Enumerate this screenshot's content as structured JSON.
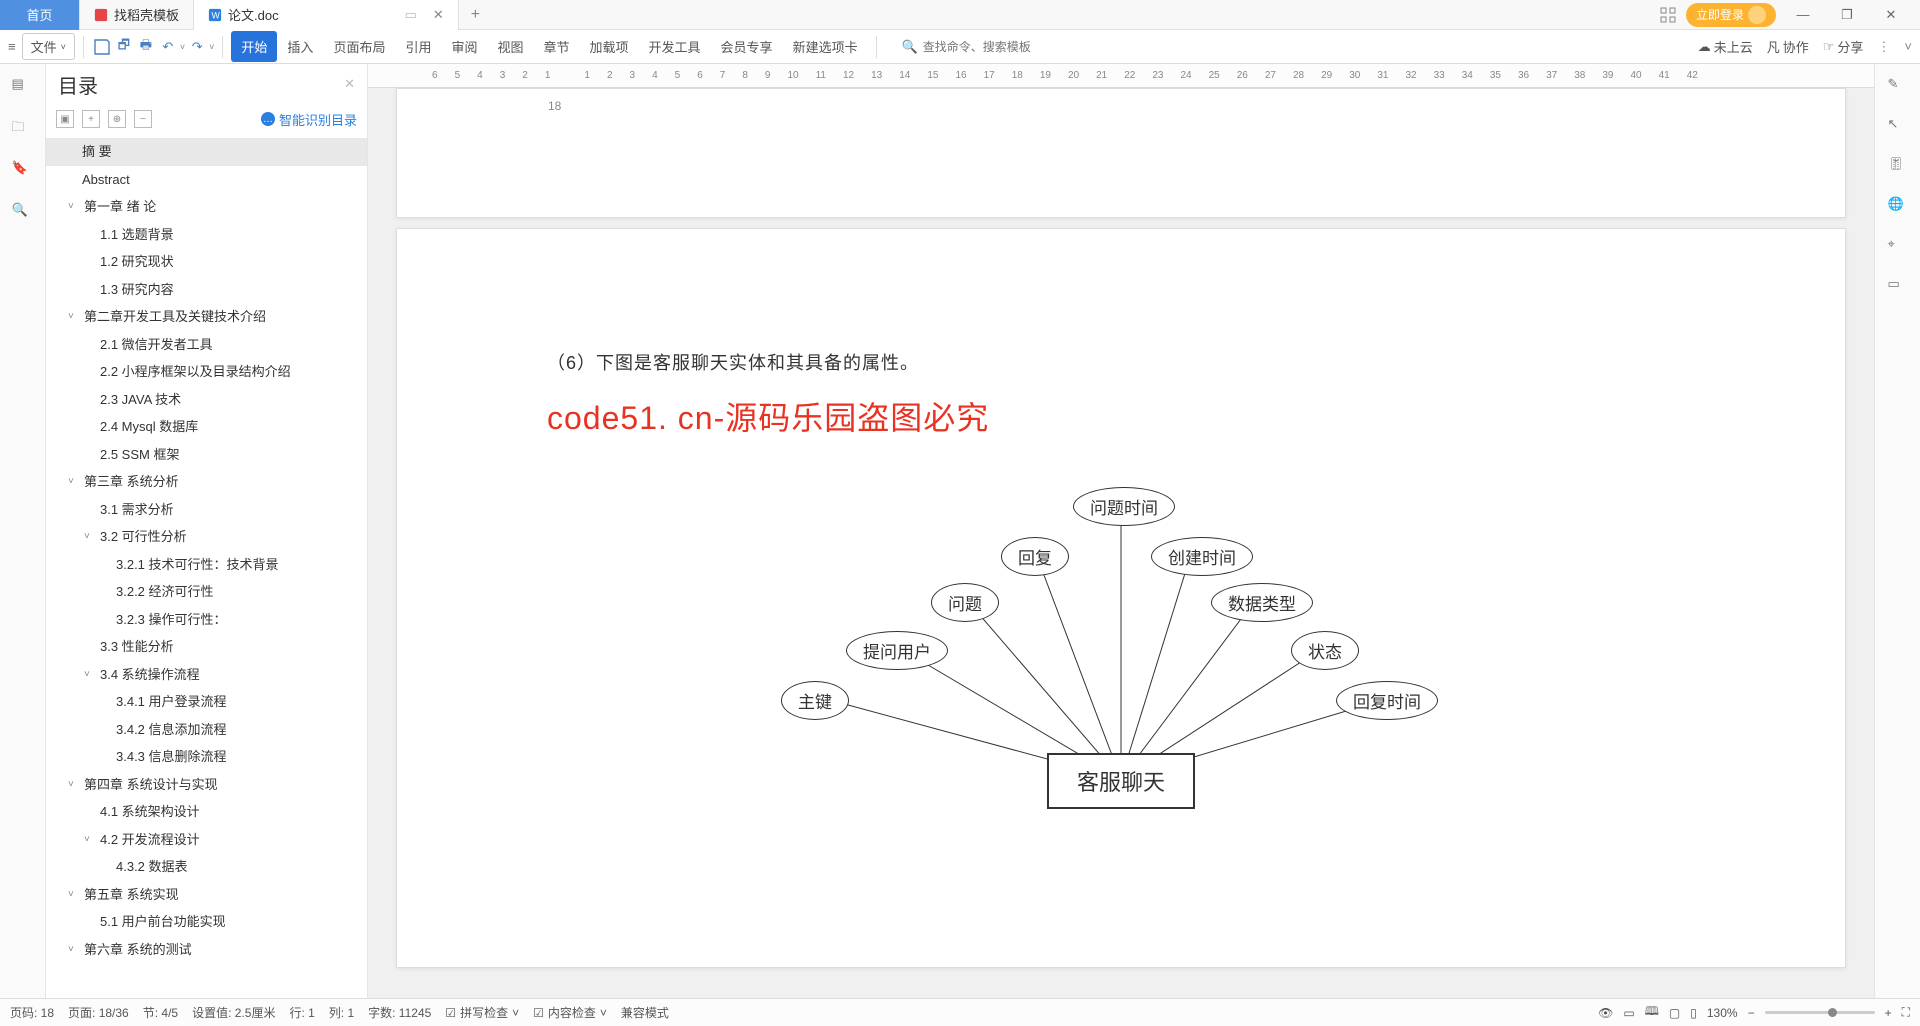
{
  "titlebar": {
    "home": "首页",
    "tab1": "找稻壳模板",
    "tab2": "论文.doc",
    "login": "立即登录"
  },
  "toolbar": {
    "file": "文件",
    "tabs": [
      "开始",
      "插入",
      "页面布局",
      "引用",
      "审阅",
      "视图",
      "章节",
      "加载项",
      "开发工具",
      "会员专享",
      "新建选项卡"
    ],
    "search_ph": "查找命令、搜索模板",
    "cloud": "未上云",
    "coop": "协作",
    "share": "分享"
  },
  "leftpanel": {
    "title": "目录",
    "smart": "智能识别目录"
  },
  "toc": [
    {
      "lvl": 0,
      "chev": "",
      "txt": "摘  要",
      "sel": true
    },
    {
      "lvl": 0,
      "chev": "",
      "txt": "Abstract"
    },
    {
      "lvl": 1,
      "chev": "v",
      "txt": "第一章  绪  论"
    },
    {
      "lvl": 2,
      "chev": "",
      "txt": "1.1 选题背景"
    },
    {
      "lvl": 2,
      "chev": "",
      "txt": "1.2 研究现状"
    },
    {
      "lvl": 2,
      "chev": "",
      "txt": "1.3 研究内容"
    },
    {
      "lvl": 1,
      "chev": "v",
      "txt": "第二章开发工具及关键技术介绍"
    },
    {
      "lvl": 2,
      "chev": "",
      "txt": "2.1 微信开发者工具"
    },
    {
      "lvl": 2,
      "chev": "",
      "txt": "2.2 小程序框架以及目录结构介绍"
    },
    {
      "lvl": 2,
      "chev": "",
      "txt": "2.3 JAVA 技术"
    },
    {
      "lvl": 2,
      "chev": "",
      "txt": "2.4    Mysql 数据库"
    },
    {
      "lvl": 2,
      "chev": "",
      "txt": "2.5 SSM 框架"
    },
    {
      "lvl": 1,
      "chev": "v",
      "txt": "第三章  系统分析"
    },
    {
      "lvl": 2,
      "chev": "",
      "txt": "3.1 需求分析"
    },
    {
      "lvl": 2,
      "chev": "v",
      "txt": "3.2 可行性分析"
    },
    {
      "lvl": 3,
      "chev": "",
      "txt": "3.2.1 技术可行性：技术背景"
    },
    {
      "lvl": 3,
      "chev": "",
      "txt": "3.2.2 经济可行性"
    },
    {
      "lvl": 3,
      "chev": "",
      "txt": "3.2.3 操作可行性："
    },
    {
      "lvl": 2,
      "chev": "",
      "txt": "3.3 性能分析"
    },
    {
      "lvl": 2,
      "chev": "v",
      "txt": "3.4 系统操作流程"
    },
    {
      "lvl": 3,
      "chev": "",
      "txt": "3.4.1 用户登录流程"
    },
    {
      "lvl": 3,
      "chev": "",
      "txt": "3.4.2 信息添加流程"
    },
    {
      "lvl": 3,
      "chev": "",
      "txt": "3.4.3 信息删除流程"
    },
    {
      "lvl": 1,
      "chev": "v",
      "txt": "第四章  系统设计与实现"
    },
    {
      "lvl": 2,
      "chev": "",
      "txt": "4.1 系统架构设计"
    },
    {
      "lvl": 2,
      "chev": "v",
      "txt": "4.2 开发流程设计"
    },
    {
      "lvl": 3,
      "chev": "",
      "txt": "4.3.2 数据表"
    },
    {
      "lvl": 1,
      "chev": "v",
      "txt": "第五章  系统实现"
    },
    {
      "lvl": 2,
      "chev": "",
      "txt": "5.1 用户前台功能实现"
    },
    {
      "lvl": 1,
      "chev": "v",
      "txt": "第六章    系统的测试"
    }
  ],
  "ruler": [
    "6",
    "5",
    "4",
    "3",
    "2",
    "1",
    "",
    "1",
    "2",
    "3",
    "4",
    "5",
    "6",
    "7",
    "8",
    "9",
    "10",
    "11",
    "12",
    "13",
    "14",
    "15",
    "16",
    "17",
    "18",
    "19",
    "20",
    "21",
    "22",
    "23",
    "24",
    "25",
    "26",
    "27",
    "28",
    "29",
    "30",
    "31",
    "32",
    "33",
    "34",
    "35",
    "36",
    "37",
    "38",
    "39",
    "40",
    "41",
    "42"
  ],
  "page": {
    "num_badge": "18",
    "line1": "（6）下图是客服聊天实体和其具备的属性。",
    "watermark": "code51. cn-源码乐园盗图必究",
    "entity": "客服聊天",
    "attrs": [
      "主键",
      "提问用户",
      "问题",
      "回复",
      "问题时间",
      "创建时间",
      "数据类型",
      "状态",
      "回复时间"
    ]
  },
  "status": {
    "pgcode": "页码: 18",
    "page": "页面: 18/36",
    "sec": "节: 4/5",
    "setval": "设置值: 2.5厘米",
    "row": "行: 1",
    "col": "列: 1",
    "words": "字数: 11245",
    "spell": "拼写检查",
    "content": "内容检查",
    "compat": "兼容模式",
    "zoom": "130%"
  }
}
